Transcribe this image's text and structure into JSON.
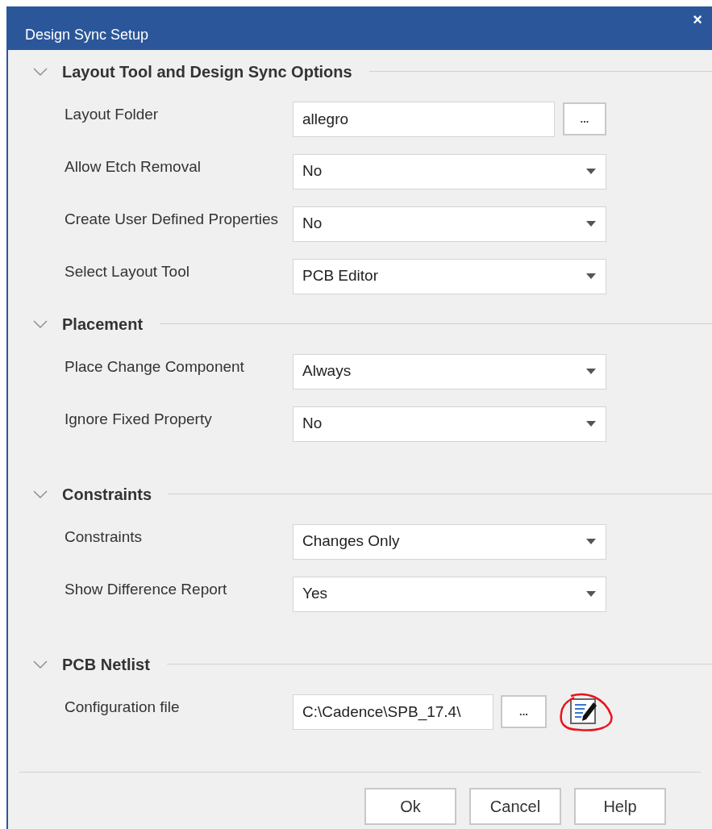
{
  "window": {
    "title": "Design Sync Setup",
    "close": "×"
  },
  "sections": [
    {
      "title": "Layout Tool and Design Sync Options",
      "expanded": true,
      "rows": [
        {
          "kind": "browse",
          "label": "Layout Folder",
          "value": "allegro",
          "button": "..."
        },
        {
          "kind": "dropdown",
          "label": "Allow Etch Removal",
          "value": "No"
        },
        {
          "kind": "dropdown",
          "label": "Create User Defined Properties",
          "value": "No"
        },
        {
          "kind": "dropdown",
          "label": "Select Layout Tool",
          "value": "PCB Editor"
        }
      ]
    },
    {
      "title": "Placement",
      "expanded": true,
      "rows": [
        {
          "kind": "dropdown",
          "label": "Place Change Component",
          "value": "Always"
        },
        {
          "kind": "dropdown",
          "label": "Ignore Fixed Property",
          "value": "No"
        }
      ]
    },
    {
      "title": "Constraints",
      "expanded": true,
      "rows": [
        {
          "kind": "dropdown",
          "label": "Constraints",
          "value": "Changes Only"
        },
        {
          "kind": "dropdown",
          "label": "Show Difference Report",
          "value": "Yes"
        }
      ]
    },
    {
      "title": "PCB Netlist",
      "expanded": true,
      "rows": [
        {
          "kind": "browse_edit",
          "label": "Configuration file",
          "value": "C:\\Cadence\\SPB_17.4\\",
          "button": "...",
          "edit_circled": true
        }
      ]
    }
  ],
  "buttons": [
    "Ok",
    "Cancel",
    "Help"
  ]
}
